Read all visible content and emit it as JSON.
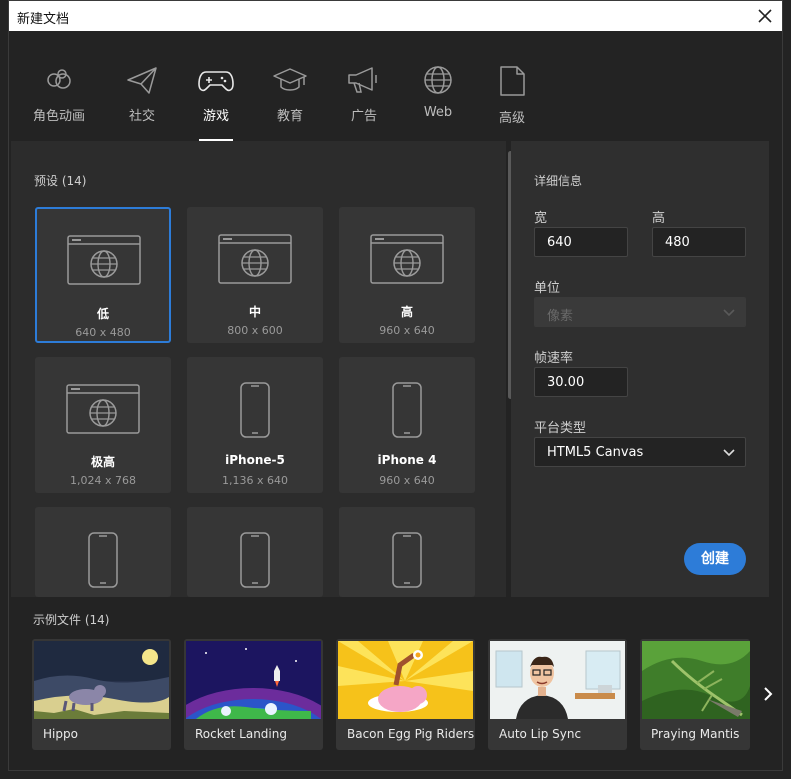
{
  "window": {
    "title": "新建文档"
  },
  "tabs": [
    {
      "label": "角色动画",
      "icon": "character-icon"
    },
    {
      "label": "社交",
      "icon": "send-icon"
    },
    {
      "label": "游戏",
      "icon": "gamepad-icon",
      "active": true
    },
    {
      "label": "教育",
      "icon": "graduation-cap-icon"
    },
    {
      "label": "广告",
      "icon": "megaphone-icon"
    },
    {
      "label": "Web",
      "icon": "globe-icon"
    },
    {
      "label": "高级",
      "icon": "document-icon"
    }
  ],
  "presets": {
    "title": "预设 (14)",
    "items": [
      {
        "name": "低",
        "size": "640 x 480",
        "icon": "browser-globe-icon",
        "selected": true
      },
      {
        "name": "中",
        "size": "800 x 600",
        "icon": "browser-globe-icon"
      },
      {
        "name": "高",
        "size": "960 x 640",
        "icon": "browser-globe-icon"
      },
      {
        "name": "极高",
        "size": "1,024 x 768",
        "icon": "browser-globe-icon"
      },
      {
        "name": "iPhone-5",
        "size": "1,136 x 640",
        "icon": "phone-icon"
      },
      {
        "name": "iPhone 4",
        "size": "960 x 640",
        "icon": "phone-icon"
      },
      {
        "name": "",
        "size": "",
        "icon": "phone-icon"
      },
      {
        "name": "",
        "size": "",
        "icon": "phone-icon"
      },
      {
        "name": "",
        "size": "",
        "icon": "phone-icon"
      }
    ]
  },
  "details": {
    "title": "详细信息",
    "width_label": "宽",
    "width_value": "640",
    "height_label": "高",
    "height_value": "480",
    "unit_label": "单位",
    "unit_value": "像素",
    "fps_label": "帧速率",
    "fps_value": "30.00",
    "platform_label": "平台类型",
    "platform_value": "HTML5 Canvas",
    "create_label": "创建"
  },
  "examples": {
    "title": "示例文件 (14)",
    "items": [
      {
        "label": "Hippo"
      },
      {
        "label": "Rocket Landing"
      },
      {
        "label": "Bacon Egg Pig Riders"
      },
      {
        "label": "Auto Lip Sync"
      },
      {
        "label": "Praying Mantis"
      }
    ]
  },
  "colors": {
    "accent": "#2d7cd8",
    "background": "#232323",
    "panel": "#2c2c2c"
  }
}
